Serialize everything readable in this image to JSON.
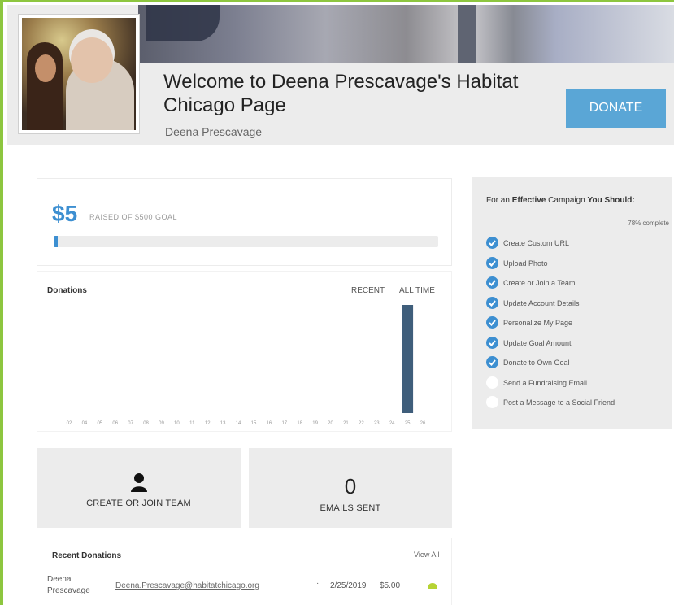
{
  "page": {
    "title": "Welcome to Deena Prescavage's Habitat Chicago Page",
    "owner": "Deena Prescavage",
    "donate_label": "DONATE",
    "colors": {
      "accent": "#3d8fd1",
      "frame": "#8dc63f",
      "button": "#5aa6d6"
    }
  },
  "fundraising": {
    "raised": "$5",
    "goal_label": "RAISED OF $500 GOAL",
    "progress_fraction": 0.01
  },
  "donations_chart": {
    "title": "Donations",
    "tabs": [
      "RECENT",
      "ALL TIME"
    ]
  },
  "chart_data": {
    "type": "bar",
    "categories": [
      "02",
      "04",
      "05",
      "06",
      "07",
      "08",
      "09",
      "10",
      "11",
      "12",
      "13",
      "14",
      "15",
      "16",
      "17",
      "18",
      "19",
      "20",
      "21",
      "22",
      "23",
      "24",
      "25",
      "26"
    ],
    "values": [
      0,
      0,
      0,
      0,
      0,
      0,
      0,
      0,
      0,
      0,
      0,
      0,
      0,
      0,
      0,
      0,
      0,
      0,
      0,
      0,
      0,
      0,
      5,
      0
    ],
    "title": "Donations",
    "legend": "none",
    "grid": false
  },
  "tiles": {
    "team_label": "CREATE OR JOIN TEAM",
    "emails_count": "0",
    "emails_label": "EMAILS SENT"
  },
  "recent_donations": {
    "title": "Recent Donations",
    "view_all": "View All",
    "rows": [
      {
        "name": "Deena Prescavage",
        "email": "Deena.Prescavage@habitatchicago.org",
        "date": "2/25/2019",
        "amount": "$5.00"
      }
    ]
  },
  "checklist": {
    "intro_pre": "For an",
    "intro_bold1": "Effective",
    "intro_mid": "Campaign",
    "intro_bold2": "You Should:",
    "percent": "78% complete",
    "items": [
      {
        "label": "Create Custom URL",
        "done": true
      },
      {
        "label": "Upload Photo",
        "done": true
      },
      {
        "label": "Create or Join a Team",
        "done": true
      },
      {
        "label": "Update Account Details",
        "done": true
      },
      {
        "label": "Personalize My Page",
        "done": true
      },
      {
        "label": "Update Goal Amount",
        "done": true
      },
      {
        "label": "Donate to Own Goal",
        "done": true
      },
      {
        "label": "Send a Fundraising Email",
        "done": false
      },
      {
        "label": "Post a Message to a Social Friend",
        "done": false
      }
    ]
  }
}
